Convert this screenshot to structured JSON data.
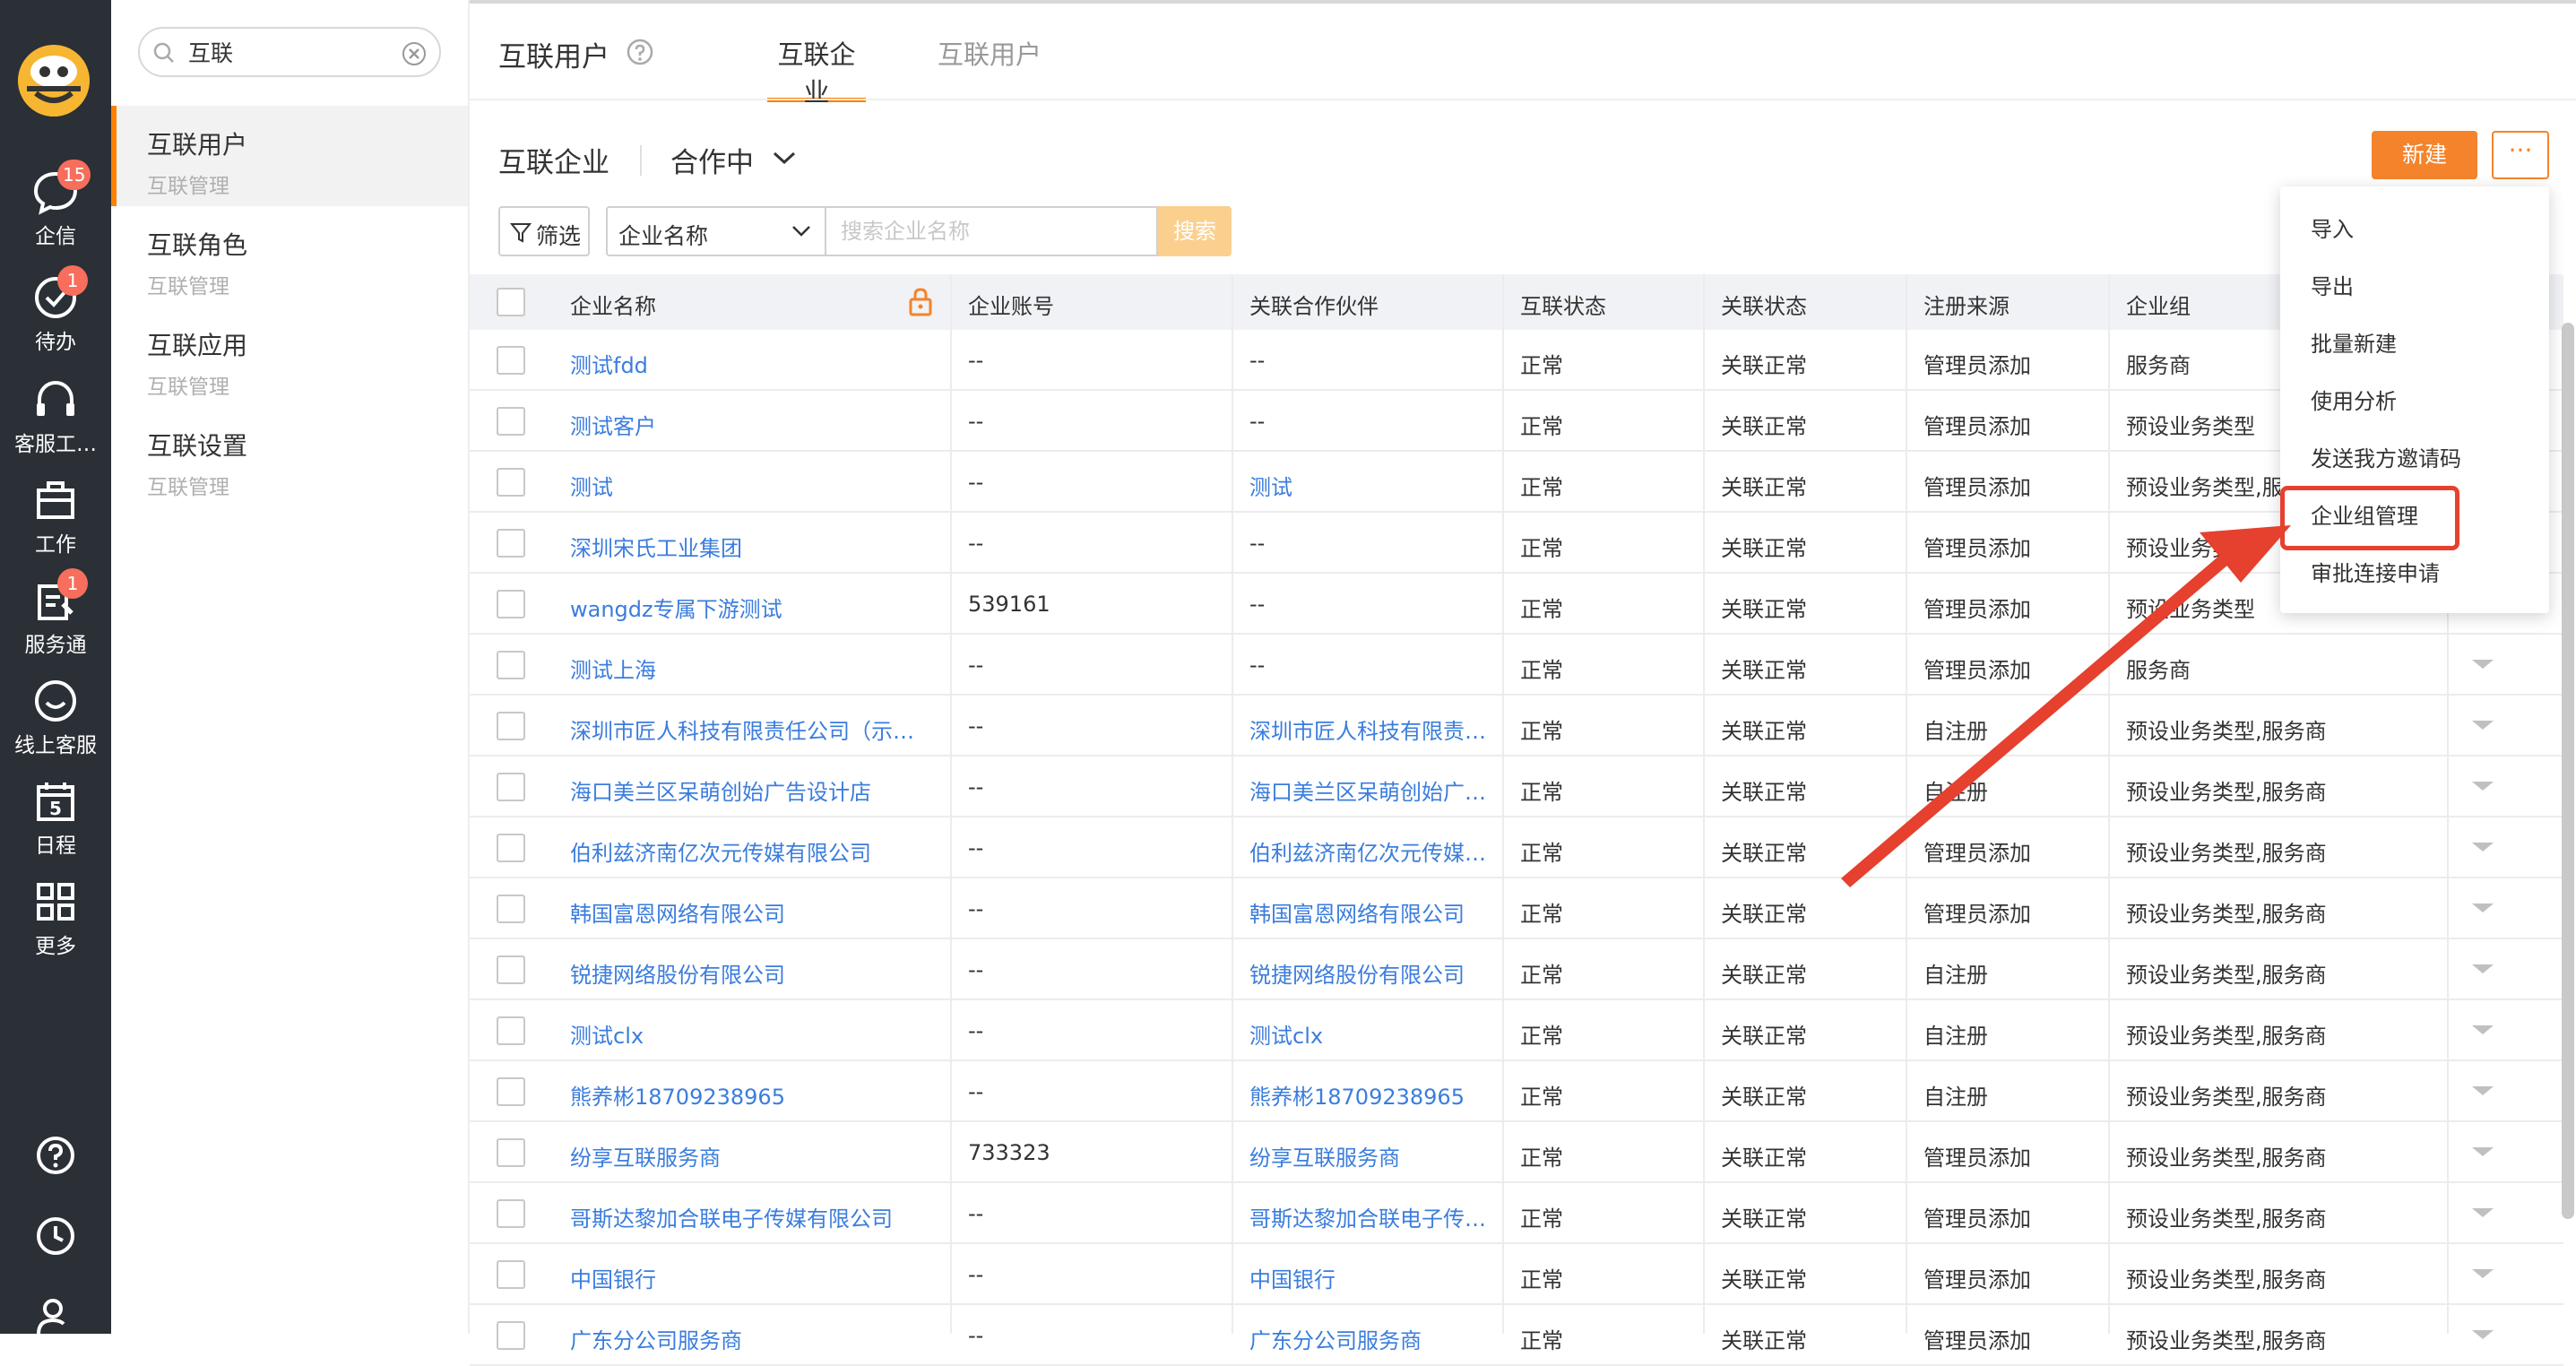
{
  "rail": {
    "items": [
      {
        "label": "企信",
        "icon": "chat-icon",
        "badge": "15"
      },
      {
        "label": "待办",
        "icon": "todo-check-icon",
        "badge": "1"
      },
      {
        "label": "客服工…",
        "icon": "headset-icon",
        "badge": ""
      },
      {
        "label": "工作",
        "icon": "briefcase-icon",
        "badge": ""
      },
      {
        "label": "服务通",
        "icon": "service-icon",
        "badge": "1"
      },
      {
        "label": "线上客服",
        "icon": "online-service-icon",
        "badge": ""
      },
      {
        "label": "日程",
        "icon": "calendar-icon",
        "badge": "5"
      },
      {
        "label": "更多",
        "icon": "grid-icon",
        "badge": ""
      }
    ]
  },
  "sidebar": {
    "search_value": "互联",
    "items": [
      {
        "title": "互联用户",
        "subtitle": "互联管理"
      },
      {
        "title": "互联角色",
        "subtitle": "互联管理"
      },
      {
        "title": "互联应用",
        "subtitle": "互联管理"
      },
      {
        "title": "互联设置",
        "subtitle": "互联管理"
      }
    ]
  },
  "header": {
    "title": "互联用户",
    "tabs": [
      {
        "label": "互联企业"
      },
      {
        "label": "互联用户"
      }
    ]
  },
  "section": {
    "title": "互联企业",
    "status": "合作中",
    "new_label": "新建",
    "more_label": "···"
  },
  "filters": {
    "filter_label": "筛选",
    "field": "企业名称",
    "placeholder": "搜索企业名称",
    "search_label": "搜索"
  },
  "table": {
    "columns": [
      "企业名称",
      "企业账号",
      "关联合作伙伴",
      "互联状态",
      "关联状态",
      "注册来源",
      "企业组"
    ],
    "rows": [
      [
        "测试fdd",
        "--",
        "--",
        "正常",
        "关联正常",
        "管理员添加",
        "服务商"
      ],
      [
        "测试客户",
        "--",
        "--",
        "正常",
        "关联正常",
        "管理员添加",
        "预设业务类型"
      ],
      [
        "测试",
        "--",
        "测试",
        "正常",
        "关联正常",
        "管理员添加",
        "预设业务类型,服"
      ],
      [
        "深圳宋氏工业集团",
        "--",
        "--",
        "正常",
        "关联正常",
        "管理员添加",
        "预设业务类型"
      ],
      [
        "wangdz专属下游测试",
        "539161",
        "--",
        "正常",
        "关联正常",
        "管理员添加",
        "预设业务类型"
      ],
      [
        "测试上海",
        "--",
        "--",
        "正常",
        "关联正常",
        "管理员添加",
        "服务商"
      ],
      [
        "深圳市匠人科技有限责任公司（示…",
        "--",
        "深圳市匠人科技有限责…",
        "正常",
        "关联正常",
        "自注册",
        "预设业务类型,服务商"
      ],
      [
        "海口美兰区呆萌创始广告设计店",
        "--",
        "海口美兰区呆萌创始广…",
        "正常",
        "关联正常",
        "自注册",
        "预设业务类型,服务商"
      ],
      [
        "伯利兹济南亿次元传媒有限公司",
        "--",
        "伯利兹济南亿次元传媒…",
        "正常",
        "关联正常",
        "管理员添加",
        "预设业务类型,服务商"
      ],
      [
        "韩国富恩网络有限公司",
        "--",
        "韩国富恩网络有限公司",
        "正常",
        "关联正常",
        "管理员添加",
        "预设业务类型,服务商"
      ],
      [
        "锐捷网络股份有限公司",
        "--",
        "锐捷网络股份有限公司",
        "正常",
        "关联正常",
        "自注册",
        "预设业务类型,服务商"
      ],
      [
        "测试clx",
        "--",
        "测试clx",
        "正常",
        "关联正常",
        "自注册",
        "预设业务类型,服务商"
      ],
      [
        "熊养彬18709238965",
        "--",
        "熊养彬18709238965",
        "正常",
        "关联正常",
        "自注册",
        "预设业务类型,服务商"
      ],
      [
        "纷享互联服务商",
        "733323",
        "纷享互联服务商",
        "正常",
        "关联正常",
        "管理员添加",
        "预设业务类型,服务商"
      ],
      [
        "哥斯达黎加合联电子传媒有限公司",
        "--",
        "哥斯达黎加合联电子传…",
        "正常",
        "关联正常",
        "管理员添加",
        "预设业务类型,服务商"
      ],
      [
        "中国银行",
        "--",
        "中国银行",
        "正常",
        "关联正常",
        "管理员添加",
        "预设业务类型,服务商"
      ],
      [
        "广东分公司服务商",
        "--",
        "广东分公司服务商",
        "正常",
        "关联正常",
        "管理员添加",
        "预设业务类型,服务商"
      ]
    ]
  },
  "menu": {
    "items": [
      "导入",
      "导出",
      "批量新建",
      "使用分析",
      "发送我方邀请码",
      "企业组管理",
      "审批连接申请"
    ],
    "highlighted": "企业组管理"
  },
  "colors": {
    "accent": "#ff8000",
    "button": "#f4832b",
    "link": "#3b7ddd",
    "rail_bg": "#2b2f36",
    "highlight": "#e6402e"
  }
}
